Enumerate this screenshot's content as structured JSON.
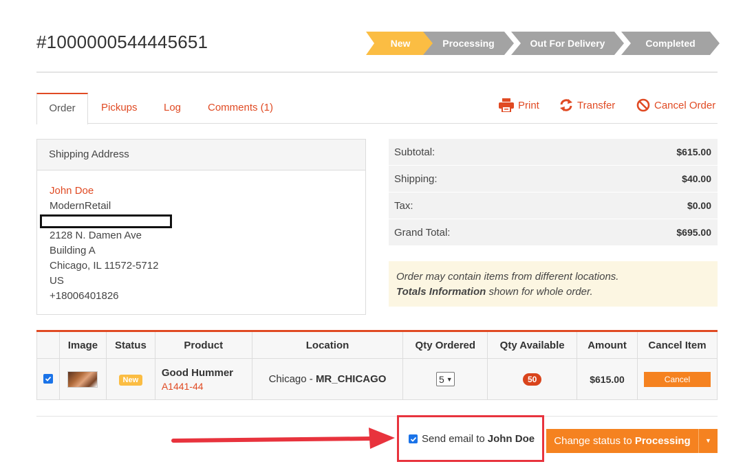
{
  "order": {
    "number": "#1000000544445651"
  },
  "status_steps": [
    {
      "label": "New",
      "active": true
    },
    {
      "label": "Processing",
      "active": false
    },
    {
      "label": "Out For Delivery",
      "active": false
    },
    {
      "label": "Completed",
      "active": false
    }
  ],
  "tabs": [
    {
      "label": "Order",
      "active": true
    },
    {
      "label": "Pickups",
      "active": false
    },
    {
      "label": "Log",
      "active": false
    },
    {
      "label": "Comments (1)",
      "active": false
    }
  ],
  "actions": {
    "print": "Print",
    "transfer": "Transfer",
    "cancel_order": "Cancel Order"
  },
  "shipping": {
    "title": "Shipping Address",
    "name": "John Doe",
    "company": "ModernRetail",
    "street": "2128 N. Damen Ave",
    "building": "Building A",
    "city_line": "Chicago, IL 11572-5712",
    "country": "US",
    "phone": "+18006401826"
  },
  "totals": {
    "subtotal_label": "Subtotal:",
    "subtotal": "$615.00",
    "shipping_label": "Shipping:",
    "shipping": "$40.00",
    "tax_label": "Tax:",
    "tax": "$0.00",
    "grand_label": "Grand Total:",
    "grand": "$695.00"
  },
  "notice": {
    "line1": "Order may contain items from different locations.",
    "bold": "Totals Information",
    "line2_rest": " shown for whole order."
  },
  "items_table": {
    "headers": [
      "",
      "Image",
      "Status",
      "Product",
      "Location",
      "Qty Ordered",
      "Qty Available",
      "Amount",
      "Cancel Item"
    ],
    "rows": [
      {
        "checked": true,
        "status": "New",
        "product_name": "Good Hummer",
        "sku": "A1441-44",
        "location_city": "Chicago - ",
        "location_code": "MR_CHICAGO",
        "qty_ordered": "5",
        "qty_available": "50",
        "amount": "$615.00",
        "cancel_label": "Cancel"
      }
    ]
  },
  "footer": {
    "email_label": "Send email to",
    "email_name": "John Doe",
    "email_checked": true,
    "status_button_prefix": "Change status to ",
    "status_button_target": "Processing"
  },
  "colors": {
    "accent": "#e04a23",
    "step_active": "#fbbd43",
    "step_inactive": "#a3a3a3",
    "button": "#f58220",
    "annotation": "#e8333d"
  }
}
